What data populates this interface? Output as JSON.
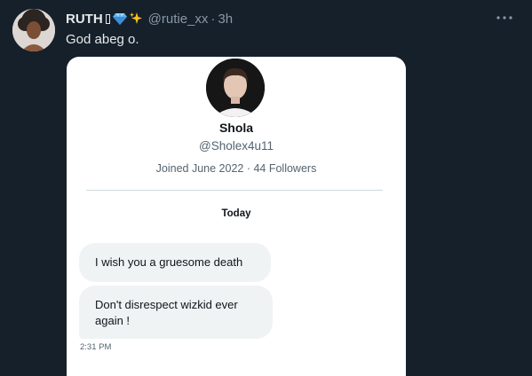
{
  "tweet": {
    "author_name": "RUTH",
    "author_name_glyph": "box-glyph",
    "author_emojis": [
      "gem-icon",
      "sparkles-icon"
    ],
    "handle": "@rutie_xx",
    "separator": "·",
    "time": "3h",
    "text": "God abeg o.",
    "more_icon": "more-horizontal-icon",
    "colors": {
      "background": "#15202b",
      "text": "#e7e9ea",
      "secondary": "#8b98a5"
    }
  },
  "dm_screenshot": {
    "profile_name": "Shola",
    "profile_handle": "@Sholex4u11",
    "profile_meta": "Joined June 2022 · 44 Followers",
    "day_label": "Today",
    "messages": [
      {
        "text": "I wish you a gruesome death"
      },
      {
        "text": "Don't disrespect wizkid ever again !"
      }
    ],
    "message_time": "2:31 PM",
    "colors": {
      "background": "#ffffff",
      "bubble": "#eff3f4",
      "text": "#0f1419",
      "secondary": "#536471"
    }
  }
}
